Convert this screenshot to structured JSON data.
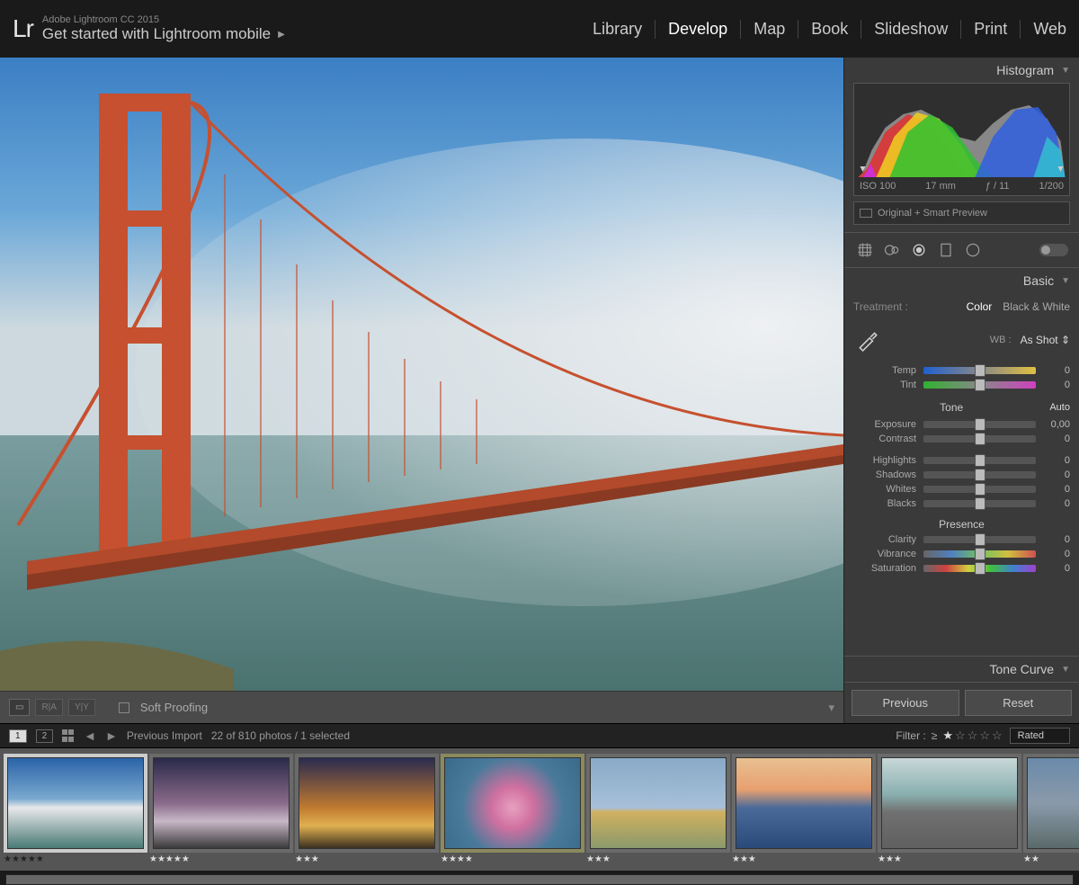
{
  "header": {
    "logo": "Lr",
    "app_name": "Adobe Lightroom CC 2015",
    "mobile_promo": "Get started with Lightroom mobile",
    "modules": [
      "Library",
      "Develop",
      "Map",
      "Book",
      "Slideshow",
      "Print",
      "Web"
    ],
    "active_module": "Develop"
  },
  "toolbar": {
    "soft_proof_label": "Soft Proofing"
  },
  "histogram": {
    "title": "Histogram",
    "iso": "ISO 100",
    "focal": "17 mm",
    "aperture": "ƒ / 11",
    "shutter": "1/200",
    "preview_label": "Original + Smart Preview"
  },
  "basic": {
    "title": "Basic",
    "treatment_label": "Treatment :",
    "treatment_color": "Color",
    "treatment_bw": "Black & White",
    "wb_label": "WB :",
    "wb_value": "As Shot",
    "temp_label": "Temp",
    "temp_val": "0",
    "tint_label": "Tint",
    "tint_val": "0",
    "tone_label": "Tone",
    "auto_label": "Auto",
    "exposure_label": "Exposure",
    "exposure_val": "0,00",
    "contrast_label": "Contrast",
    "contrast_val": "0",
    "highlights_label": "Highlights",
    "highlights_val": "0",
    "shadows_label": "Shadows",
    "shadows_val": "0",
    "whites_label": "Whites",
    "whites_val": "0",
    "blacks_label": "Blacks",
    "blacks_val": "0",
    "presence_label": "Presence",
    "clarity_label": "Clarity",
    "clarity_val": "0",
    "vibrance_label": "Vibrance",
    "vibrance_val": "0",
    "saturation_label": "Saturation",
    "saturation_val": "0"
  },
  "tonecurve_title": "Tone Curve",
  "buttons": {
    "previous": "Previous",
    "reset": "Reset"
  },
  "filmstrip": {
    "badge1": "1",
    "badge2": "2",
    "source": "Previous Import",
    "count": "22 of 810 photos / 1 selected",
    "filter_label": "Filter :",
    "filter_op": "≥",
    "filter_select": "Rated",
    "thumbs": [
      {
        "rating": "★★★★★",
        "sel": true
      },
      {
        "rating": "★★★★★"
      },
      {
        "rating": "★★★"
      },
      {
        "rating": "★★★★",
        "greenish": true
      },
      {
        "rating": "★★★"
      },
      {
        "rating": "★★★"
      },
      {
        "rating": "★★★"
      },
      {
        "rating": "★★"
      }
    ]
  }
}
